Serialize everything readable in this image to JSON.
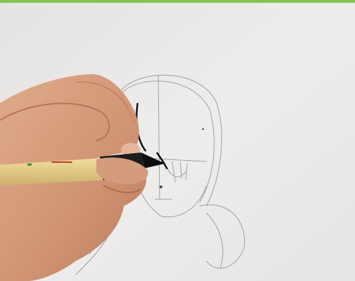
{
  "scene": {
    "description_tags": [
      "paper",
      "pencil-sketch",
      "hand",
      "pen"
    ],
    "colors": {
      "paper": "#eceae7",
      "top_strip": "#7fc64a",
      "skin": "#d9a07f",
      "pen_body": "#e8cf8a",
      "pen_tip": "#1a1a1a",
      "sketch_line": "#9a9a9a"
    }
  }
}
